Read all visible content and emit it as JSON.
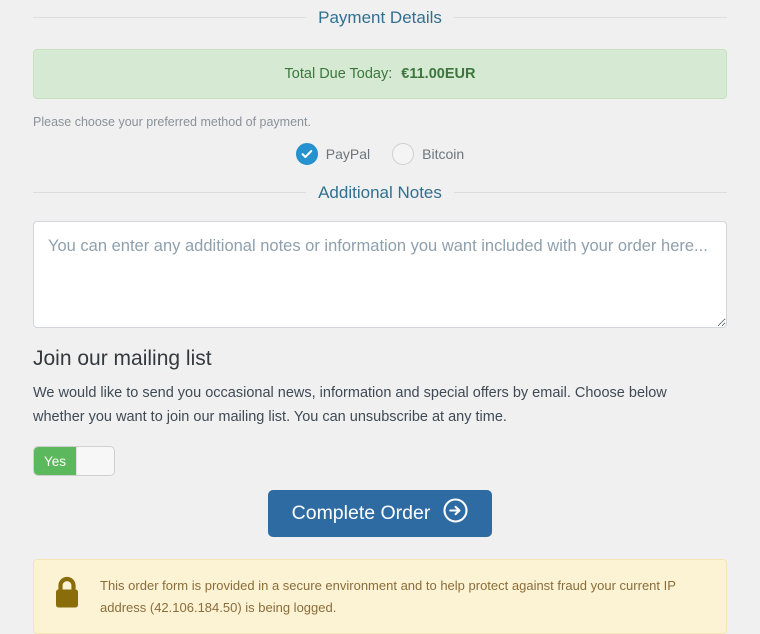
{
  "sections": {
    "payment_details_heading": "Payment Details",
    "additional_notes_heading": "Additional Notes"
  },
  "total": {
    "label": "Total Due Today:",
    "value": "€11.00EUR",
    "bg_color": "#d6ead3",
    "text_color": "#3c763d"
  },
  "payment": {
    "instructions": "Please choose your preferred method of payment.",
    "methods": [
      {
        "label": "PayPal",
        "selected": true,
        "icon": "check-icon"
      },
      {
        "label": "Bitcoin",
        "selected": false,
        "icon": "radio-empty-icon"
      }
    ],
    "selected_color": "#2591ce"
  },
  "notes": {
    "value": "",
    "placeholder": "You can enter any additional notes or information you want included with your order here..."
  },
  "mailing_list": {
    "heading": "Join our mailing list",
    "description": "We would like to send you occasional news, information and special offers by email. Choose below whether you want to join our mailing list. You can unsubscribe at any time.",
    "toggle": {
      "state_label": "Yes",
      "on": true,
      "on_color": "#5cb85c"
    }
  },
  "order": {
    "button_label": "Complete Order",
    "button_icon": "arrow-right-circle-icon",
    "button_color": "#2e6ba3"
  },
  "secure_notice": {
    "icon": "lock-icon",
    "icon_color": "#8a6d0b",
    "text": "This order form is provided in a secure environment and to help protect against fraud your current IP address (42.106.184.50) is being logged.",
    "ip_address": "42.106.184.50",
    "bg_color": "#fcf3d4",
    "text_color": "#8a6d3b"
  }
}
